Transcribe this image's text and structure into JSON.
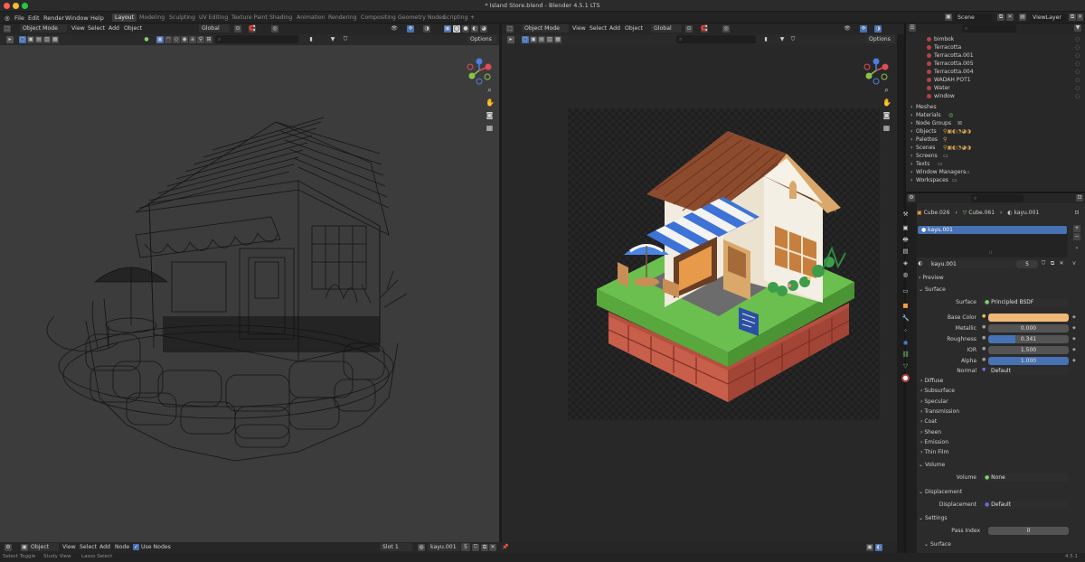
{
  "window": {
    "title": "* Island Store.blend - Blender 4.5.1 LTS"
  },
  "menu": {
    "items": [
      "File",
      "Edit",
      "Render",
      "Window",
      "Help"
    ]
  },
  "workspaces": [
    "Layout",
    "Modeling",
    "Sculpting",
    "UV Editing",
    "Texture Paint",
    "Shading",
    "Animation",
    "Rendering",
    "Compositing",
    "Geometry Nodes",
    "Scripting",
    "+"
  ],
  "scene": {
    "name": "Scene",
    "view_layer": "ViewLayer"
  },
  "viewport_left": {
    "mode": "Object Mode",
    "menus": [
      "View",
      "Select",
      "Add",
      "Object"
    ],
    "transform": "Global",
    "options": "Options",
    "shading": "wireframe"
  },
  "viewport_right": {
    "mode": "Object Mode",
    "menus": [
      "View",
      "Select",
      "Add",
      "Object"
    ],
    "transform": "Global",
    "options": "Options",
    "shading": "rendered"
  },
  "outliner": {
    "materials": [
      "bimbok",
      "Terracotta",
      "Terracotta.001",
      "Terracotta.005",
      "Terracotta.004",
      "WADAH POT1",
      "Water",
      "window"
    ],
    "datablocks": [
      "Meshes",
      "Materials",
      "Node Groups",
      "Objects",
      "Palettes",
      "Scenes",
      "Screens",
      "Texts",
      "Window Managers",
      "Workspaces"
    ]
  },
  "properties": {
    "breadcrumb": [
      "Cube.026",
      "Cube.061",
      "kayu.001"
    ],
    "slot": "kayu.001",
    "material_name": "kayu.001",
    "user_count": "5",
    "sections": {
      "preview": "Preview",
      "surface": "Surface"
    },
    "surface_shader_label": "Surface",
    "surface_shader": "Principled BSDF",
    "base_color_label": "Base Color",
    "base_color": "#f0b878",
    "fields": [
      {
        "label": "Metallic",
        "value": "0.000",
        "fill": 0.0
      },
      {
        "label": "Roughness",
        "value": "0.341",
        "fill": 0.341
      },
      {
        "label": "IOR",
        "value": "1.500",
        "fill": 0.0
      },
      {
        "label": "Alpha",
        "value": "1.000",
        "fill": 1.0
      }
    ],
    "normal_label": "Normal",
    "normal_value": "Default",
    "subpanels": [
      "Diffuse",
      "Subsurface",
      "Specular",
      "Transmission",
      "Coat",
      "Sheen",
      "Emission",
      "Thin Film"
    ],
    "volume_header": "Volume",
    "volume_label": "Volume",
    "volume_value": "None",
    "displacement_header": "Displacement",
    "displacement_label": "Displacement",
    "displacement_value": "Default",
    "settings_header": "Settings",
    "pass_index_label": "Pass Index",
    "pass_index_value": "0",
    "settings_surface": "Surface"
  },
  "node_editor_header": {
    "type": "Object",
    "menus": [
      "View",
      "Select",
      "Add",
      "Node"
    ],
    "use_nodes_label": "Use Nodes",
    "use_nodes": true,
    "slot": "Slot 1",
    "material": "kayu.001",
    "users": "5"
  },
  "statusbar": {
    "hints": [
      "Select Toggle",
      "Study View",
      "Lasso Select"
    ],
    "version": "4.5.1"
  },
  "colors": {
    "accent_blue": "#4772b3",
    "header_bg": "#262626",
    "viewport_left_bg": "#3a3a3a",
    "viewport_right_bg": "#2a2a2a",
    "axis_x": "#e04c55",
    "axis_y": "#8bc34a",
    "axis_z": "#4c7ee0"
  }
}
